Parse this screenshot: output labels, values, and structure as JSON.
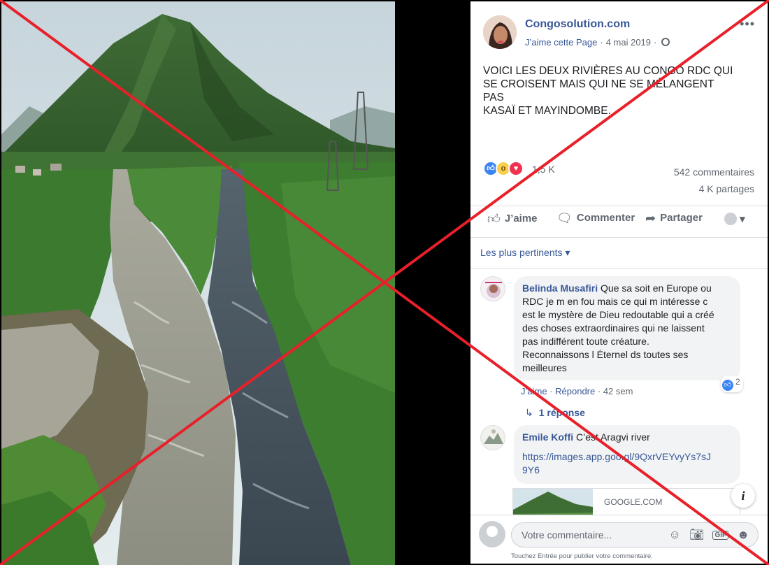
{
  "post": {
    "page_name": "Congosolution.com",
    "like_page": "J’aime cette Page",
    "date": "4 mai 2019",
    "text_lines": [
      "VOICI LES DEUX RIVIÈRES AU CONGO RDC QUI",
      "SE CROISENT MAIS QUI NE SE MÉLANGENT",
      "PAS",
      "KASAÏ ET MAYINDOMBE."
    ],
    "reaction_count": "1,5 K",
    "comments_count": "542 commentaires",
    "shares_count": "4 K partages"
  },
  "actions": {
    "like": "J’aime",
    "comment": "Commenter",
    "share": "Partager"
  },
  "sort_label": "Les plus pertinents",
  "comments": [
    {
      "name": "Belinda Musafiri",
      "lines": [
        "Que sa soit en Europe ou",
        "RDC je m en fou mais ce qui m intéresse c",
        "est le mystère de Dieu redoutable qui a créé",
        "des choses extraordinaires qui ne laissent",
        "pas indifférent toute créature.",
        "Reconnaissons l Éternel ds toutes ses",
        "meilleures"
      ],
      "like_label": "J’aime",
      "reply_label": "Répondre",
      "age": "42 sem",
      "like_count": "2",
      "replies": "1 réponse"
    },
    {
      "name": "Emile Koffi",
      "text": "C’est Aragvi river",
      "link_line1": "https://images.app.goo.gl/9QxrVEYvyYs7sJ",
      "link_line2": "9Y6",
      "preview_domain": "GOOGLE.COM"
    }
  ],
  "composer": {
    "placeholder": "Votre commentaire...",
    "hint": "Touchez Entrée pour publier votre commentaire."
  },
  "icons": [
    "globe-icon",
    "more-icon",
    "like-icon",
    "comment-icon",
    "share-icon",
    "emoji-icon",
    "camera-icon",
    "gif-icon",
    "sticker-icon",
    "info-icon",
    "reply-arrow-icon"
  ],
  "colors": {
    "link_blue": "#385898",
    "cross_red": "#e8202a",
    "like_blue": "#3b84f5",
    "love_red": "#f0314f"
  }
}
